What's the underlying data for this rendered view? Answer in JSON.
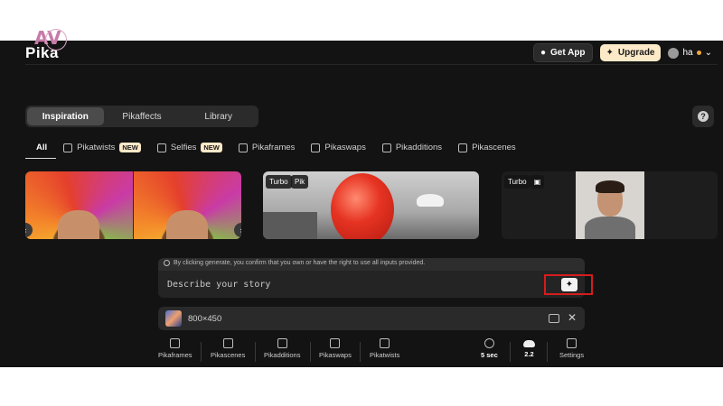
{
  "watermark": {
    "text": "AV"
  },
  "header": {
    "logo": "Pika",
    "get_app": "Get App",
    "upgrade": "Upgrade",
    "user_name": "ha"
  },
  "tabs": [
    {
      "label": "Inspiration",
      "active": true
    },
    {
      "label": "Pikaffects",
      "active": false
    },
    {
      "label": "Library",
      "active": false
    }
  ],
  "help_label": "?",
  "filters": [
    {
      "label": "All",
      "badge": "",
      "active": true
    },
    {
      "label": "Pikatwists",
      "badge": "NEW"
    },
    {
      "label": "Selfies",
      "badge": "NEW"
    },
    {
      "label": "Pikaframes",
      "badge": ""
    },
    {
      "label": "Pikaswaps",
      "badge": ""
    },
    {
      "label": "Pikadditions",
      "badge": ""
    },
    {
      "label": "Pikascenes",
      "badge": ""
    }
  ],
  "cards": [
    {
      "tags": []
    },
    {
      "tags": [
        "Turbo",
        "Pik"
      ]
    },
    {
      "tags": [
        "Turbo"
      ]
    }
  ],
  "prompt": {
    "notice": "By clicking generate, you confirm that you own or have the right to use all inputs provided.",
    "placeholder": "Describe your story",
    "generate_glyph": "✦"
  },
  "image": {
    "name": "800×450"
  },
  "toolbar": {
    "items": [
      {
        "label": "Pikaframes"
      },
      {
        "label": "Pikascenes"
      },
      {
        "label": "Pikadditions"
      },
      {
        "label": "Pikaswaps"
      },
      {
        "label": "Pikatwists"
      }
    ],
    "duration": "5 sec",
    "model": "2.2",
    "settings": "Settings"
  },
  "colors": {
    "background": "#131313",
    "badge": "#fbe9c8",
    "highlight_border": "#d61c1c"
  }
}
